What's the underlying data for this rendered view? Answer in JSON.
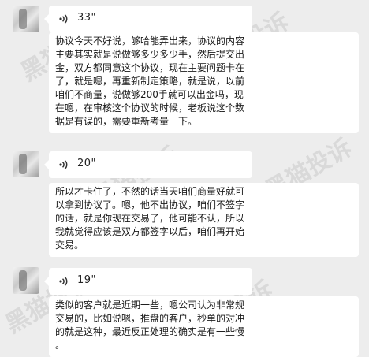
{
  "messages": [
    {
      "duration": "33\"",
      "lines": [
        "协议今天不好说，够哈能弄出来，协议的内容",
        "主要其实就是说做够多少多少手，然后提交出",
        "金，双方都同意这个协议，现在主要问题卡在",
        "了，就是嗯，再重新制定策略，就是说，以前",
        "咱们不商量，说做够200手就可以出金吗，现",
        "在嗯，在审核这个协议的时候，老板说这个数",
        "据是有误的，需要重新考量一下。"
      ]
    },
    {
      "duration": "20\"",
      "lines": [
        "所以才卡住了，不然的话当天咱们商量好就可",
        "以拿到协议了。嗯，他不出协议，咱们不签字",
        "的话，就是你现在交易了，他可能不认，所以",
        "我就觉得应该是双方都签字以后，咱们再开始",
        "交易。"
      ]
    },
    {
      "duration": "19\"",
      "lines": [
        "类似的客户就是近期一些，嗯公司认为非常规",
        "交易的，比如说嗯，推盘的客户，秒单的对冲",
        "的就是这种，最近反正处理的确实是有一些慢",
        "。"
      ]
    }
  ],
  "watermark": "黑猫投诉"
}
